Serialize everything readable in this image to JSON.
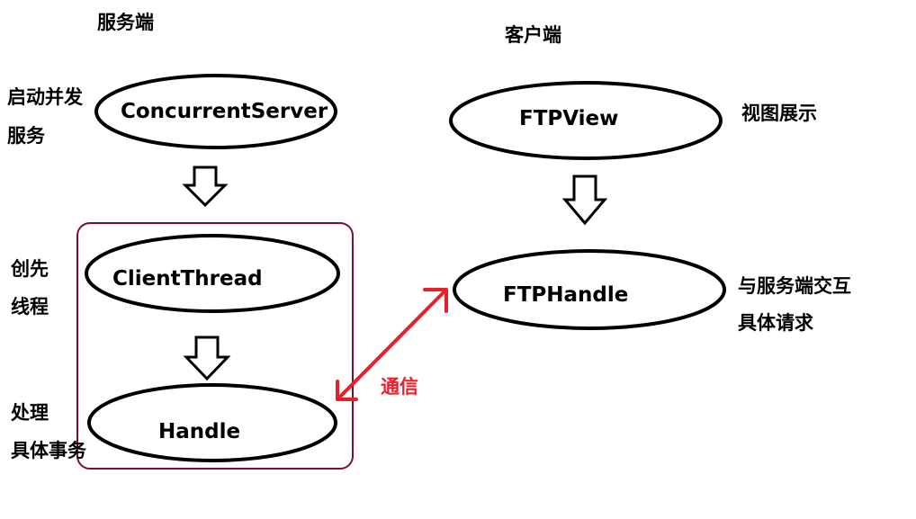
{
  "server": {
    "heading": "服务端",
    "nodes": {
      "concurrent_server": "ConcurrentServer",
      "client_thread": "ClientThread",
      "handle": "Handle"
    },
    "notes": {
      "start_line1": "启动并发",
      "start_line2": "服务",
      "create_line1": "创先",
      "create_line2": "线程",
      "process_line1": "处理",
      "process_line2": "具体事务"
    }
  },
  "client": {
    "heading": "客户端",
    "nodes": {
      "ftp_view": "FTPView",
      "ftp_handle": "FTPHandle"
    },
    "notes": {
      "view_note": "视图展示",
      "interact_line1": "与服务端交互",
      "interact_line2": "具体请求"
    }
  },
  "connection": {
    "label": "通信",
    "color": "#e8202a"
  },
  "colors": {
    "stroke": "#000000",
    "group_border": "#7a1226",
    "accent_red": "#e8202a"
  }
}
